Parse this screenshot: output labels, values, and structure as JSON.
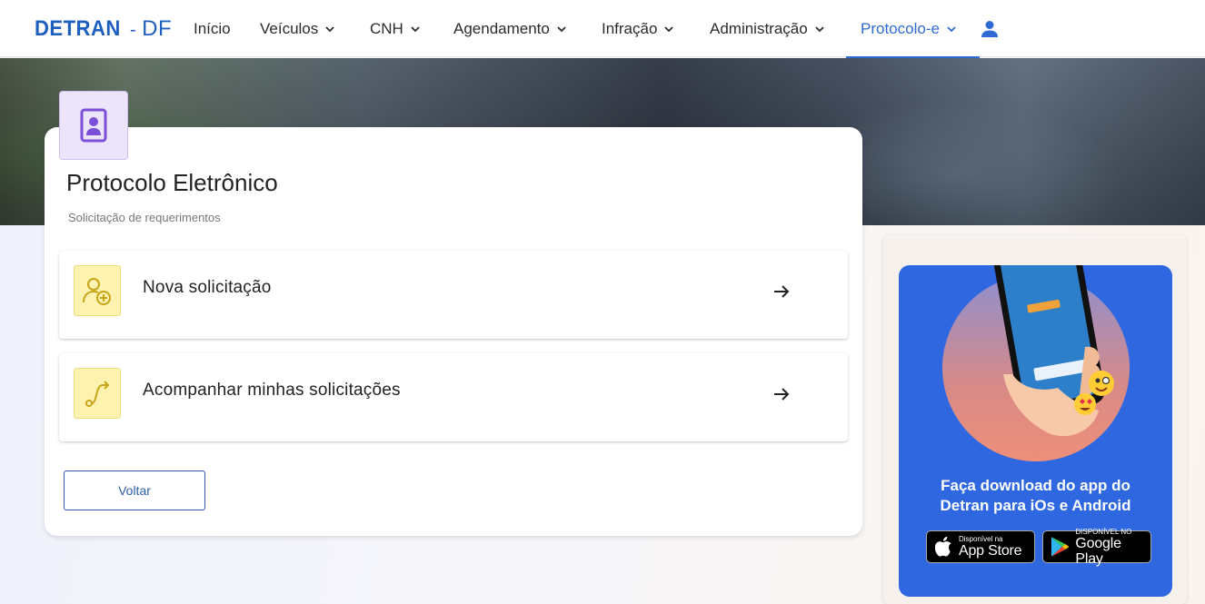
{
  "logo": {
    "brand": "DETRAN",
    "separator": "-",
    "state": "DF"
  },
  "nav": {
    "items": [
      {
        "label": "Início",
        "dropdown": false,
        "active": false
      },
      {
        "label": "Veículos",
        "dropdown": true,
        "active": false
      },
      {
        "label": "CNH",
        "dropdown": true,
        "active": false
      },
      {
        "label": "Agendamento",
        "dropdown": true,
        "active": false
      },
      {
        "label": "Infração",
        "dropdown": true,
        "active": false
      },
      {
        "label": "Administração",
        "dropdown": true,
        "active": false
      },
      {
        "label": "Protocolo-e",
        "dropdown": true,
        "active": true
      }
    ],
    "user_icon": "user-icon"
  },
  "page": {
    "title": "Protocolo Eletrônico",
    "subtitle": "Solicitação de requerimentos",
    "header_icon": "id-badge-icon"
  },
  "options": [
    {
      "label": "Nova solicitação",
      "icon": "user-plus-icon"
    },
    {
      "label": "Acompanhar minhas solicitações",
      "icon": "route-icon"
    }
  ],
  "back_button": {
    "label": "Voltar"
  },
  "promo": {
    "line1": "Faça download do app do",
    "line2": "Detran para iOs e Android",
    "app_store": {
      "small": "Disponível na",
      "big": "App Store"
    },
    "google_play": {
      "small": "DISPONÍVEL NO",
      "big": "Google Play"
    }
  },
  "colors": {
    "accent": "#2f6bd3",
    "logo": "#1f5fbf",
    "promo_bg": "#2e67e0",
    "option_icon_bg": "#fdf2b0",
    "header_icon_bg": "#ece4fb"
  }
}
